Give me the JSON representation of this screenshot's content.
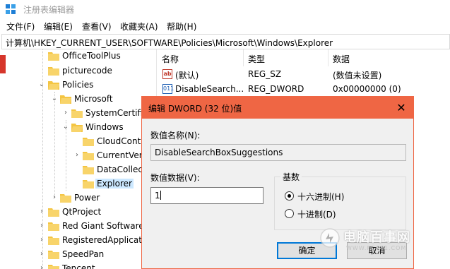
{
  "window": {
    "title": "注册表编辑器"
  },
  "menu": [
    "文件(F)",
    "编辑(E)",
    "查看(V)",
    "收藏夹(A)",
    "帮助(H)"
  ],
  "address": "计算机\\HKEY_CURRENT_USER\\SOFTWARE\\Policies\\Microsoft\\Windows\\Explorer",
  "tree": [
    {
      "label": "OfficeToolPlus"
    },
    {
      "label": "picturecode"
    },
    {
      "label": "Policies"
    },
    {
      "label": "Microsoft"
    },
    {
      "label": "SystemCertificates"
    },
    {
      "label": "Windows"
    },
    {
      "label": "CloudContent"
    },
    {
      "label": "CurrentVersion"
    },
    {
      "label": "DataCollection"
    },
    {
      "label": "Explorer"
    },
    {
      "label": "Power"
    },
    {
      "label": "QtProject"
    },
    {
      "label": "Red Giant Software"
    },
    {
      "label": "RegisteredApplications"
    },
    {
      "label": "SpeedPan"
    },
    {
      "label": "Tencent"
    }
  ],
  "list": {
    "headers": {
      "name": "名称",
      "type": "类型",
      "data": "数据"
    },
    "rows": [
      {
        "name": "(默认)",
        "type": "REG_SZ",
        "data": "(数值未设置)",
        "icon": "string-value-icon"
      },
      {
        "name": "DisableSearch...",
        "type": "REG_DWORD",
        "data": "0x00000000 (0)",
        "icon": "dword-value-icon"
      }
    ]
  },
  "dialog": {
    "title": "编辑 DWORD (32 位)值",
    "name_label": "数值名称(N):",
    "name_value": "DisableSearchBoxSuggestions",
    "data_label": "数值数据(V):",
    "data_value": "1",
    "base_label": "基数",
    "radio_hex": "十六进制(H)",
    "radio_dec": "十进制(D)",
    "selected_base": "hex",
    "ok_label": "确定",
    "cancel_label": "取消"
  },
  "watermark": {
    "text": "电脑百事网",
    "sub": "WWW.PC841.COM"
  },
  "colors": {
    "dialog_accent": "#ef6644",
    "selection": "#cce8ff",
    "folder": "#f4c542",
    "default_button_border": "#0078d7"
  }
}
